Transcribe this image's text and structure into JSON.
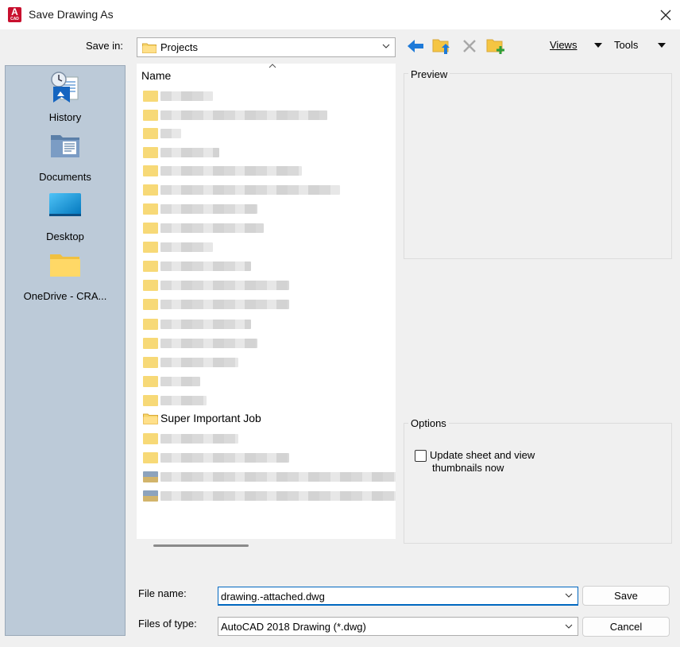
{
  "window": {
    "title": "Save Drawing As",
    "app_icon_letter": "A",
    "app_icon_sub": "CAD"
  },
  "toolbar": {
    "save_in_label": "Save in:",
    "save_in_value": "Projects",
    "views_label": "Views",
    "tools_label": "Tools"
  },
  "places": [
    {
      "label": "History",
      "icon": "history-icon"
    },
    {
      "label": "Documents",
      "icon": "documents-icon"
    },
    {
      "label": "Desktop",
      "icon": "desktop-icon"
    },
    {
      "label": "OneDrive - CRA...",
      "icon": "folder-icon"
    }
  ],
  "file_list": {
    "column_name": "Name",
    "visible_item": "Super Important Job"
  },
  "preview": {
    "label": "Preview"
  },
  "options": {
    "label": "Options",
    "thumbnail_line1": "Update sheet and view",
    "thumbnail_line2": "thumbnails now",
    "thumbnail_checked": false
  },
  "form": {
    "file_name_label": "File name:",
    "file_name_value": "drawing.-attached.dwg",
    "files_of_type_label": "Files of type:",
    "files_of_type_value": "AutoCAD 2018 Drawing (*.dwg)",
    "save_label": "Save",
    "cancel_label": "Cancel"
  },
  "colors": {
    "app_icon": "#c8102e",
    "places_bg": "#bccad8",
    "focus_border": "#0067c0",
    "back_arrow": "#1e7ad8",
    "new_folder_plus": "#2e9e3a"
  }
}
